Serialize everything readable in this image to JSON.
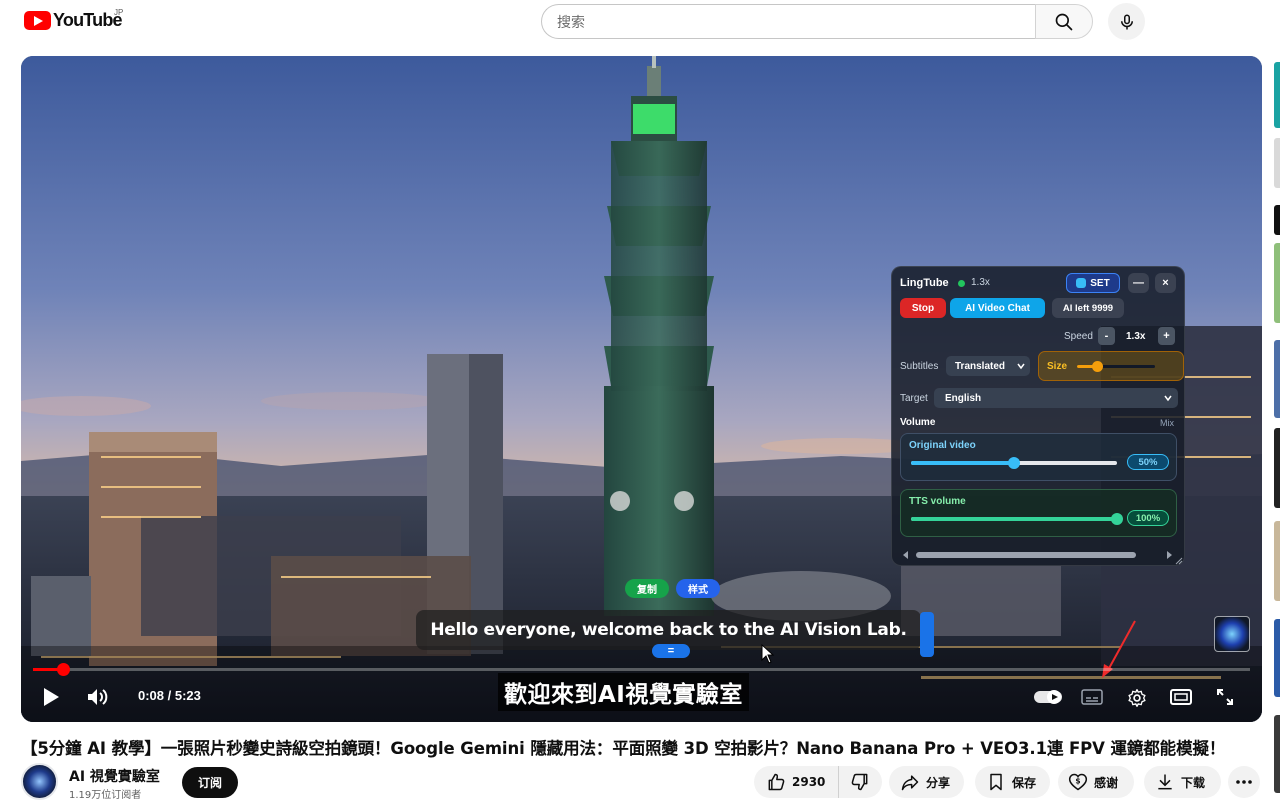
{
  "header": {
    "logo_text": "YouTube",
    "region": "JP",
    "search_placeholder": "搜索",
    "search_value": ""
  },
  "player": {
    "time_current": "0:08",
    "time_separator": " / ",
    "time_total": "5:23",
    "progress_fraction": 0.0248,
    "caption_english": "Hello everyone, welcome back to the AI Vision Lab.",
    "caption_chinese": "歡迎來到AI視覺實驗室",
    "caption_buttons": {
      "copy": "复制",
      "style": "样式"
    },
    "caption_drag_symbol": "="
  },
  "lingtube": {
    "title": "LingTube",
    "speed_tag": "1.3x",
    "set_label": "SET",
    "minimize_symbol": "—",
    "close_symbol": "×",
    "stop_label": "Stop",
    "ai_chat_label": "AI Video Chat",
    "ai_left_label": "AI left 9999",
    "speed_label": "Speed",
    "speed_minus": "-",
    "speed_value": "1.3x",
    "speed_plus": "+",
    "subtitles_label": "Subtitles",
    "subtitles_value": "Translated",
    "size_label": "Size",
    "size_fraction": 0.25,
    "target_label": "Target",
    "target_value": "English",
    "volume_title": "Volume",
    "mix_label": "Mix",
    "original_video": {
      "label": "Original video",
      "value": "50%",
      "fraction": 0.5
    },
    "tts_volume": {
      "label": "TTS volume",
      "value": "100%",
      "fraction": 1.0
    }
  },
  "video": {
    "title": "【5分鐘 AI 教學】一張照片秒變史詩級空拍鏡頭！Google Gemini 隱藏用法：平面照變 3D 空拍影片？Nano Banana Pro + VEO3.1連 FPV 運鏡都能模擬！",
    "channel_name": "AI 視覺實驗室",
    "channel_subs": "1.19万位订阅者",
    "subscribe_label": "订阅",
    "like_count": "2930",
    "share_label": "分享",
    "save_label": "保存",
    "thanks_label": "感谢",
    "download_label": "下载"
  },
  "colors": {
    "brand_red": "#ff0000",
    "stop_red": "#dc2626",
    "chat_blue": "#0ea5e9",
    "copy_green": "#16a34a",
    "style_blue": "#2563eb"
  }
}
